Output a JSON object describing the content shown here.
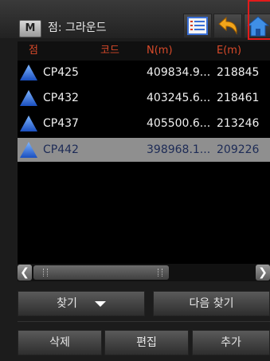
{
  "header": {
    "mode_button": "M",
    "title": "점: 그라운드"
  },
  "table": {
    "columns": [
      "점",
      "코드",
      "N(m)",
      "E(m)"
    ],
    "rows": [
      {
        "name": "CP425",
        "code": "",
        "n": "409834.9...",
        "e": "218845",
        "selected": false
      },
      {
        "name": "CP432",
        "code": "",
        "n": "403245.6...",
        "e": "218461",
        "selected": false
      },
      {
        "name": "CP437",
        "code": "",
        "n": "405500.6...",
        "e": "213246",
        "selected": false
      },
      {
        "name": "CP442",
        "code": "",
        "n": "398968.1...",
        "e": "209226",
        "selected": true
      }
    ]
  },
  "buttons": {
    "find": "찾기",
    "find_next": "다음 찾기",
    "delete": "삭제",
    "edit": "편집",
    "add": "추가"
  },
  "colors": {
    "header_text": "#d94a2a",
    "selected_row": "#8f8f8f",
    "highlight": "#e21b1b",
    "point_icon": "#2f6fe0"
  }
}
